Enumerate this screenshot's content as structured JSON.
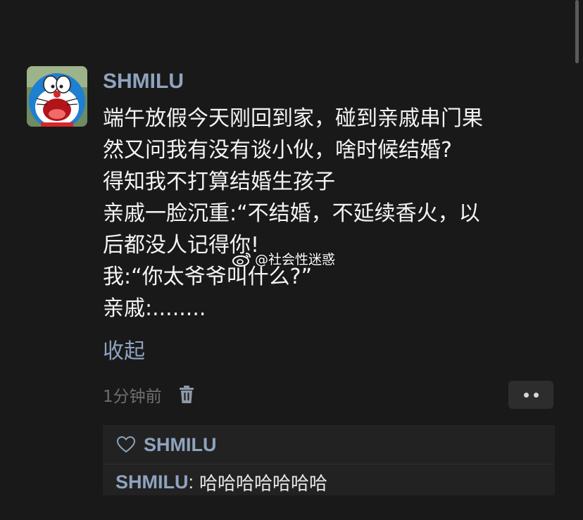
{
  "post": {
    "username": "SHMILU",
    "lines": [
      "端午放假今天刚回到家，碰到亲戚串门果",
      "然又问我有没有谈小伙，啥时候结婚?",
      "得知我不打算结婚生孩子",
      "亲戚一脸沉重:“不结婚，不延续香火，以",
      "后都没人记得你!",
      "我:“你太爷爷叫什么?”",
      "亲戚:........"
    ],
    "collapse_label": "收起",
    "timestamp": "1分钟前",
    "avatar_icon": "doraemon-avatar",
    "delete_icon": "trash-icon",
    "more_icon": "more-dots-icon"
  },
  "watermark": {
    "icon": "weibo-logo-icon",
    "text": "@社会性迷惑"
  },
  "likes": {
    "icon": "heart-outline-icon",
    "name": "SHMILU"
  },
  "reply": {
    "author": "SHMILU",
    "separator": ":",
    "text": "哈哈哈哈哈哈哈"
  },
  "colors": {
    "background": "#191919",
    "name_accent": "#8fa3bf",
    "body_text": "#f4f4f4",
    "muted_text": "#6f6f6f",
    "panel": "#222222"
  }
}
